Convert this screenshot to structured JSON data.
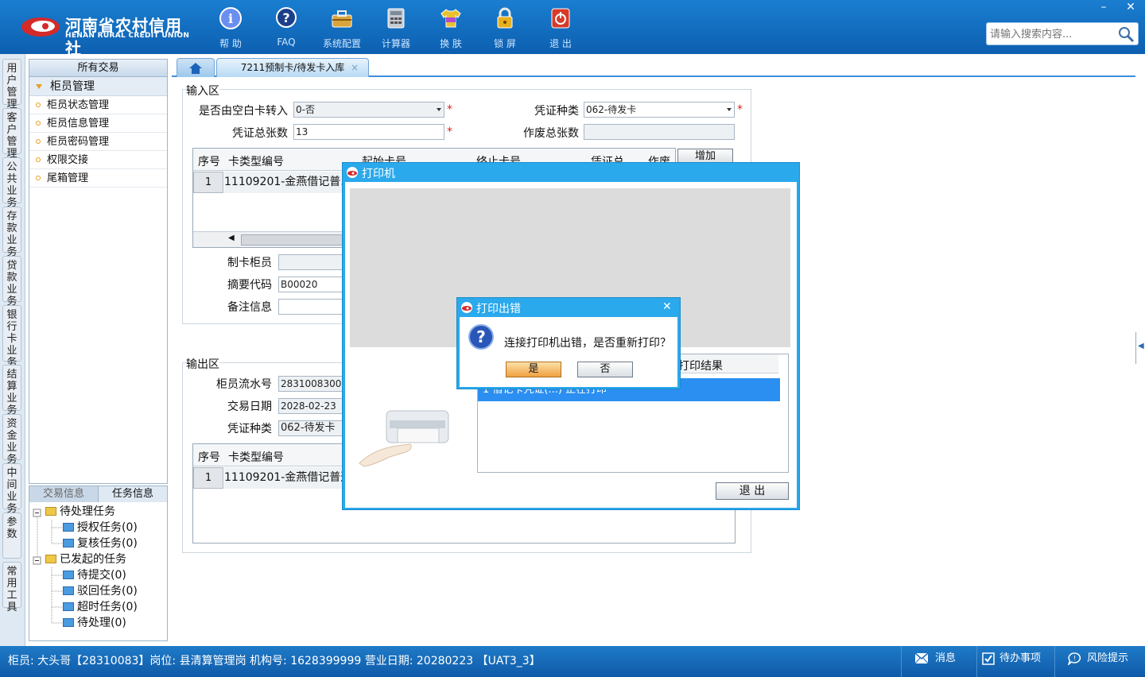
{
  "header": {
    "logo_cn": "河南省农村信用社",
    "logo_en": "HENAN RURAL CREDIT UNION",
    "toolbar": [
      {
        "label": "帮 助",
        "icon": "info-icon"
      },
      {
        "label": "FAQ",
        "icon": "question-icon"
      },
      {
        "label": "系统配置",
        "icon": "toolbox-icon"
      },
      {
        "label": "计算器",
        "icon": "calculator-icon"
      },
      {
        "label": "换 肤",
        "icon": "shirt-icon"
      },
      {
        "label": "锁 屏",
        "icon": "lock-icon"
      },
      {
        "label": "退 出",
        "icon": "power-icon"
      }
    ],
    "search_placeholder": "请输入搜索内容...",
    "minimize": "–",
    "close": "✕"
  },
  "vtabs": [
    "用户管理",
    "客户管理",
    "公共业务",
    "存款业务",
    "贷款业务",
    "银行卡业务",
    "结算业务",
    "资金业务",
    "中间业务",
    "参数",
    "常用工具"
  ],
  "left_panel": {
    "title": "所有交易",
    "group": "柜员管理",
    "items": [
      "柜员状态管理",
      "柜员信息管理",
      "柜员密码管理",
      "权限交接",
      "尾箱管理"
    ]
  },
  "task_panel": {
    "tabs": [
      "交易信息",
      "任务信息"
    ],
    "pending": "待处理任务",
    "pending_items": [
      "授权任务(0)",
      "复核任务(0)"
    ],
    "initiated": "已发起的任务",
    "initiated_items": [
      "待提交(0)",
      "驳回任务(0)",
      "超时任务(0)",
      "待处理(0)"
    ]
  },
  "tabs": {
    "active": "7211预制卡/待发卡入库",
    "close": "×"
  },
  "input_area": {
    "title": "输入区",
    "blank_card_label": "是否由空白卡转入",
    "blank_card_value": "0-否",
    "voucher_type_label": "凭证种类",
    "voucher_type_value": "062-待发卡",
    "total_label": "凭证总张数",
    "total_value": "13",
    "void_total_label": "作废总张数",
    "void_total_value": "",
    "grid_headers": [
      "序号",
      "卡类型编号",
      "起始卡号",
      "终止卡号",
      "凭证总",
      "作废"
    ],
    "grid_row": {
      "no": "1",
      "card_type": "11109201-金燕借记普..."
    },
    "add_button": "增加",
    "maker_label": "制卡柜员",
    "summary_label": "摘要代码",
    "summary_value": "B00020",
    "remark_label": "备注信息"
  },
  "output_area": {
    "title": "输出区",
    "serial_label": "柜员流水号",
    "serial_value": "283100830000",
    "date_label": "交易日期",
    "date_value": "2028-02-23",
    "voucher_type_label": "凭证种类",
    "voucher_type_value": "062-待发卡",
    "grid_headers": [
      "序号",
      "卡类型编号"
    ],
    "grid_row": {
      "no": "1",
      "card_type": "11109201-金燕借记普通"
    }
  },
  "printer_dialog": {
    "title": "打印机",
    "result_header": "打印结果",
    "row_text": "1  借记卡凭证(...)  正在打印",
    "exit_button": "退 出"
  },
  "error_dialog": {
    "title": "打印出错",
    "message": "连接打印机出错，是否重新打印？",
    "yes": "是",
    "no": "否",
    "close": "✕"
  },
  "status_bar": {
    "text": "柜员: 大头哥【28310083】岗位: 县清算管理岗  机构号: 1628399999  营业日期: 20280223  【UAT3_3】",
    "message": "消息",
    "todo": "待办事项",
    "risk": "风险提示"
  },
  "colors": {
    "header_blue": "#0d5fb0",
    "dialog_blue": "#2aa9ec",
    "required_red": "#e02020",
    "selected_row": "#2a8ff0"
  }
}
